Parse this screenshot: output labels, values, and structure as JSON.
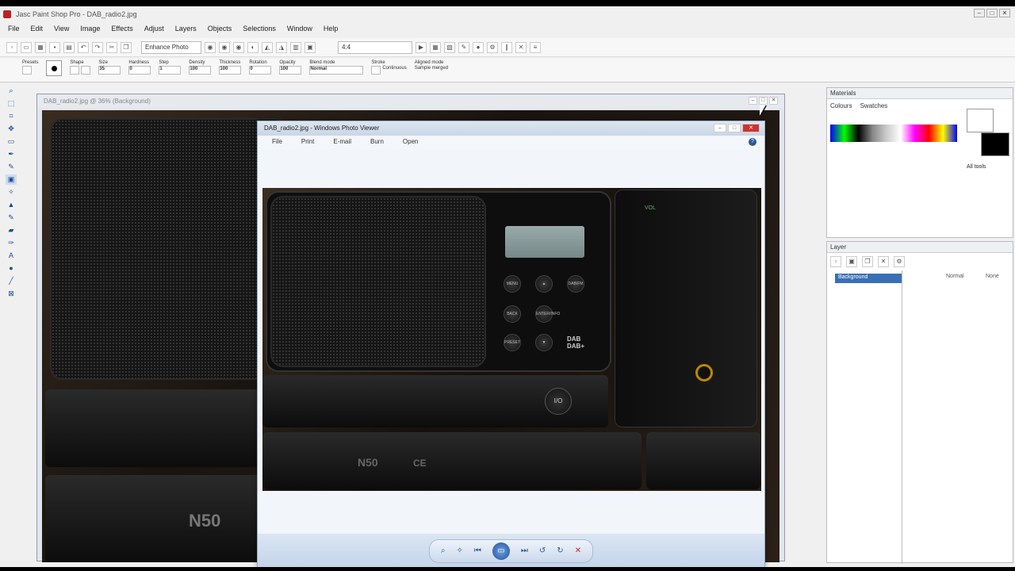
{
  "app": {
    "title": "Jasc Paint Shop Pro - DAB_radio2.jpg"
  },
  "menu": [
    "File",
    "Edit",
    "View",
    "Image",
    "Effects",
    "Adjust",
    "Layers",
    "Objects",
    "Selections",
    "Window",
    "Help"
  ],
  "toolbar": {
    "enhance_label": "Enhance Photo",
    "zoom_field": "4:4"
  },
  "options": {
    "presets": "Presets",
    "shape": "Shape",
    "size_label": "Size",
    "size_value": "35",
    "hardness_label": "Hardness",
    "hardness_value": "0",
    "step_label": "Step",
    "step_value": "1",
    "density_label": "Density",
    "density_value": "100",
    "thickness_label": "Thickness",
    "thickness_value": "100",
    "rotation_label": "Rotation",
    "rotation_value": "0",
    "opacity_label": "Opacity",
    "opacity_value": "100",
    "blend_label": "Blend mode",
    "blend_value": "Normal",
    "stroke_label": "Stroke",
    "continuous": "Continuous",
    "aligned_mode": "Aligned mode",
    "sample_merged": "Sample merged"
  },
  "document": {
    "title": "DAB_radio2.jpg @ 36% (Background)"
  },
  "photo_viewer": {
    "title": "DAB_radio2.jpg - Windows Photo Viewer",
    "menu": [
      "File",
      "Print",
      "E-mail",
      "Burn",
      "Open"
    ]
  },
  "radio": {
    "vol": "VOL",
    "buttons": [
      "MENU",
      "BACK",
      "PRESET",
      "DAB/FM",
      "ENTER/INFO"
    ],
    "power": "I/O",
    "logo": "DAB DAB+",
    "model": "N50",
    "ce": "CE"
  },
  "materials": {
    "title": "Materials",
    "tab_colours": "Colours",
    "tab_swatches": "Swatches",
    "all_tools": "All tools"
  },
  "layers": {
    "title": "Layer",
    "item": "Background",
    "blend": "Normal",
    "opacity": "None"
  },
  "colors": {
    "accent": "#3a6fb5",
    "titlebar": "#c9d6e6"
  }
}
